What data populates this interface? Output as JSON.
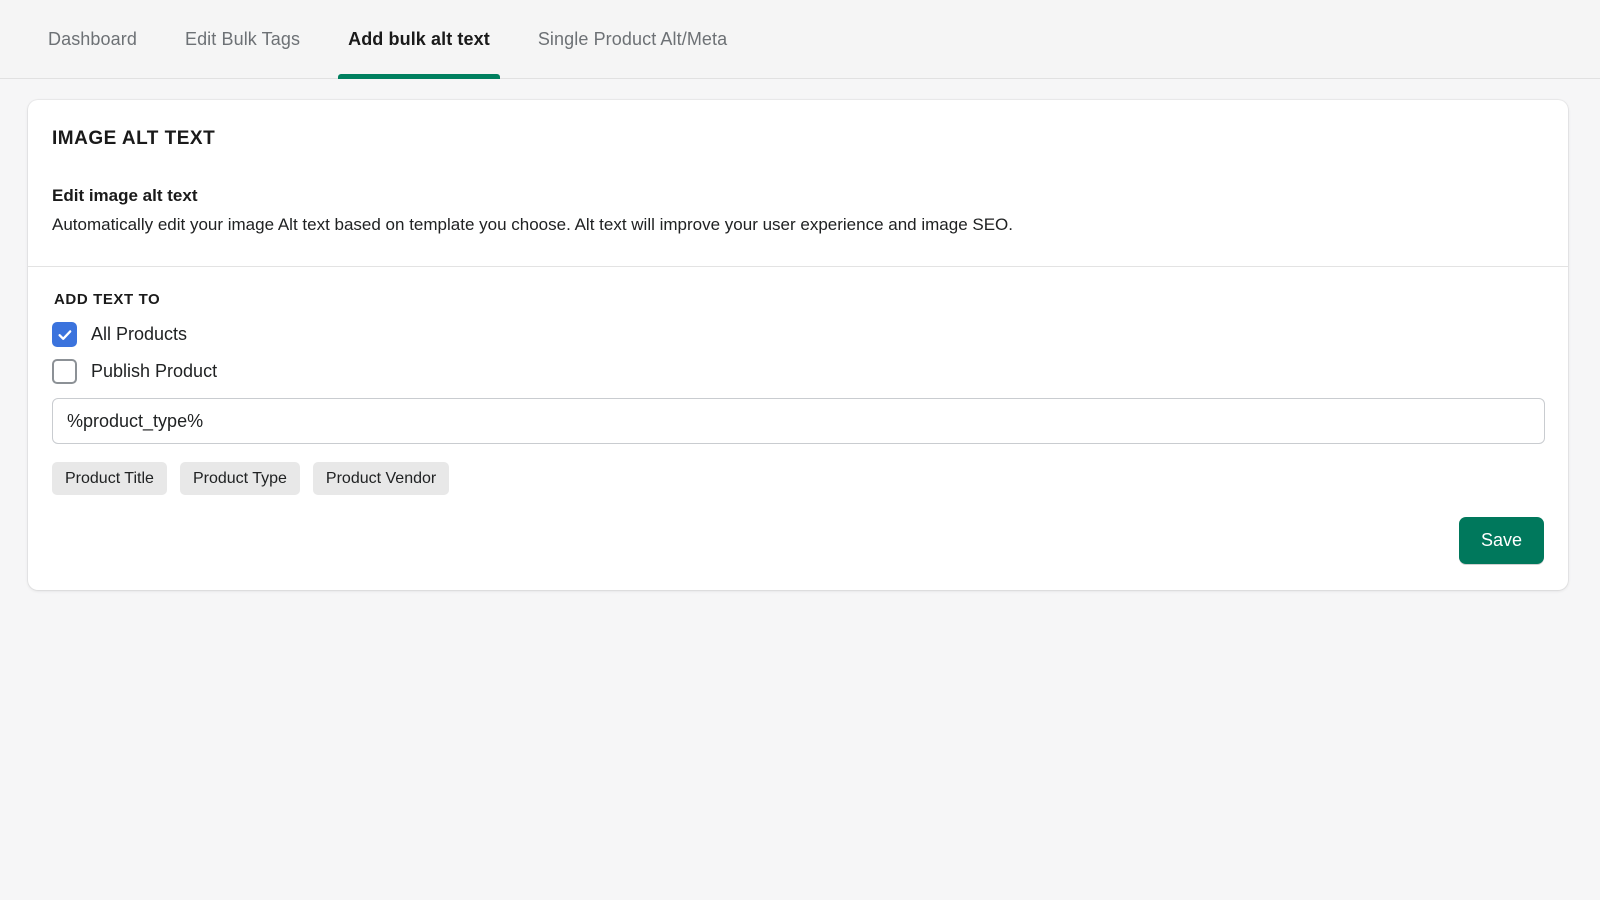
{
  "tabs": [
    {
      "label": "Dashboard",
      "active": false
    },
    {
      "label": "Edit Bulk Tags",
      "active": false
    },
    {
      "label": "Add bulk alt text",
      "active": true
    },
    {
      "label": "Single Product Alt/Meta",
      "active": false
    }
  ],
  "card": {
    "section_title": "IMAGE ALT TEXT",
    "sub_title": "Edit image alt text",
    "sub_desc": "Automatically edit your image Alt text based on template you choose. Alt text will improve your user experience and image SEO.",
    "group_label": "ADD TEXT TO",
    "checkboxes": [
      {
        "label": "All Products",
        "checked": true
      },
      {
        "label": "Publish Product",
        "checked": false
      }
    ],
    "template_field": {
      "value": "%product_type%",
      "placeholder": "%product_type%"
    },
    "tags": [
      {
        "label": "Product Title"
      },
      {
        "label": "Product Type"
      },
      {
        "label": "Product Vendor"
      }
    ],
    "save_label": "Save"
  },
  "colors": {
    "page_background": "#f6f6f7",
    "tab_bar_background": "#f5f5f5",
    "active_tab_underline": "#00805f",
    "checkbox_checked": "#3b73dd",
    "checkbox_border": "#8c9196",
    "save_button": "#00785c",
    "tag_button": "#e8e8e8",
    "card_background": "#ffffff",
    "divider": "#e3e3e3"
  }
}
